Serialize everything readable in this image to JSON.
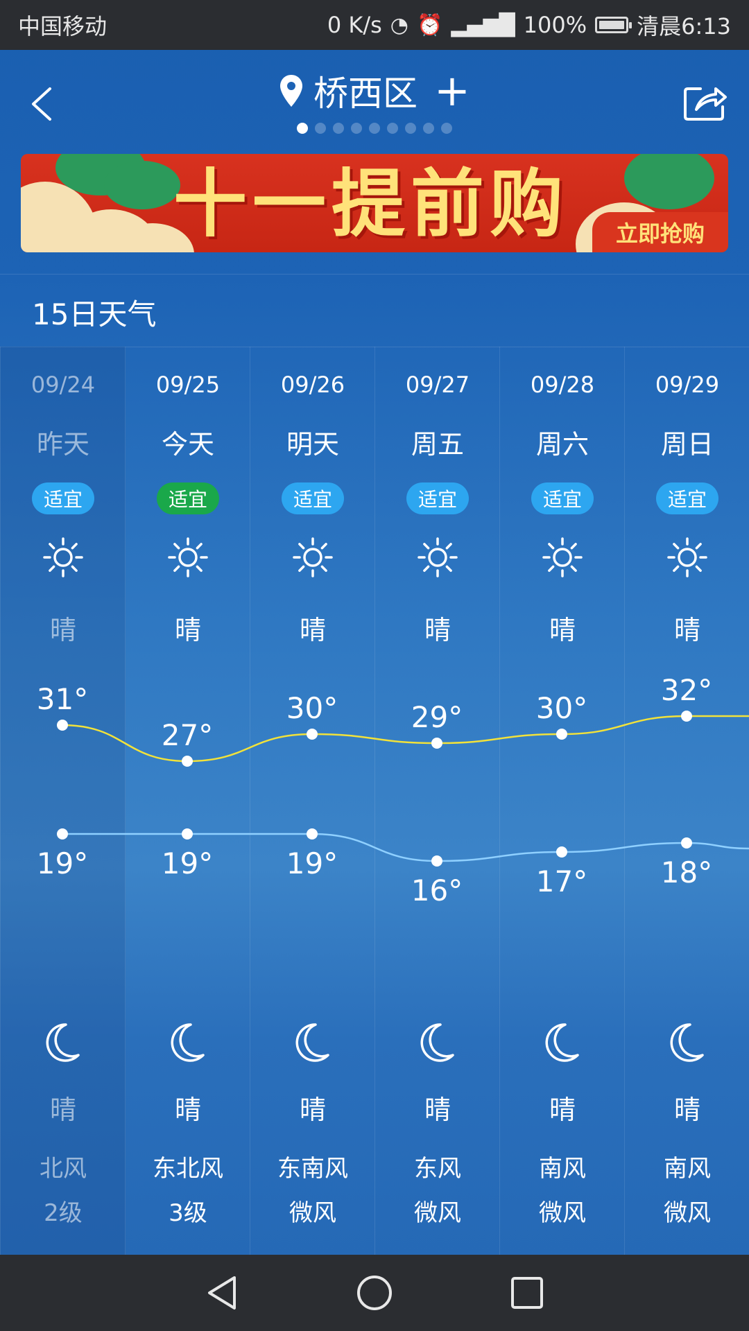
{
  "status_bar": {
    "carrier": "中国移动",
    "net_speed": "0 K/s",
    "battery": "100%",
    "time": "清晨6:13",
    "icons": [
      "hd-icon",
      "alarm-icon",
      "4g-signal-icon",
      "battery-icon"
    ]
  },
  "header": {
    "location": "桥西区",
    "add_symbol": "+",
    "page_count": 9,
    "active_page": 0
  },
  "banner": {
    "headline": "十一提前购",
    "button": "立即抢购"
  },
  "section": {
    "title": "15日天气"
  },
  "forecast": [
    {
      "date": "09/24",
      "day": "昨天",
      "badge": "适宜",
      "badge_color": "#2da6f0",
      "day_cond": "晴",
      "high": "31°",
      "low": "19°",
      "night_cond": "晴",
      "wind_dir": "北风",
      "wind_level": "2级",
      "high_value": 31,
      "low_value": 19
    },
    {
      "date": "09/25",
      "day": "今天",
      "badge": "适宜",
      "badge_color": "#1aa84a",
      "day_cond": "晴",
      "high": "27°",
      "low": "19°",
      "night_cond": "晴",
      "wind_dir": "东北风",
      "wind_level": "3级",
      "high_value": 27,
      "low_value": 19
    },
    {
      "date": "09/26",
      "day": "明天",
      "badge": "适宜",
      "badge_color": "#2da6f0",
      "day_cond": "晴",
      "high": "30°",
      "low": "19°",
      "night_cond": "晴",
      "wind_dir": "东南风",
      "wind_level": "微风",
      "high_value": 30,
      "low_value": 19
    },
    {
      "date": "09/27",
      "day": "周五",
      "badge": "适宜",
      "badge_color": "#2da6f0",
      "day_cond": "晴",
      "high": "29°",
      "low": "16°",
      "night_cond": "晴",
      "wind_dir": "东风",
      "wind_level": "微风",
      "high_value": 29,
      "low_value": 16
    },
    {
      "date": "09/28",
      "day": "周六",
      "badge": "适宜",
      "badge_color": "#2da6f0",
      "day_cond": "晴",
      "high": "30°",
      "low": "17°",
      "night_cond": "晴",
      "wind_dir": "南风",
      "wind_level": "微风",
      "high_value": 30,
      "low_value": 17
    },
    {
      "date": "09/29",
      "day": "周日",
      "badge": "适宜",
      "badge_color": "#2da6f0",
      "day_cond": "晴",
      "high": "32°",
      "low": "18°",
      "night_cond": "晴",
      "wind_dir": "南风",
      "wind_level": "微风",
      "high_value": 32,
      "low_value": 18
    }
  ],
  "colors": {
    "high_line": "#f2e23a",
    "low_line": "#8fd0ff",
    "badge_default": "#2da6f0",
    "badge_today": "#1aa84a"
  }
}
